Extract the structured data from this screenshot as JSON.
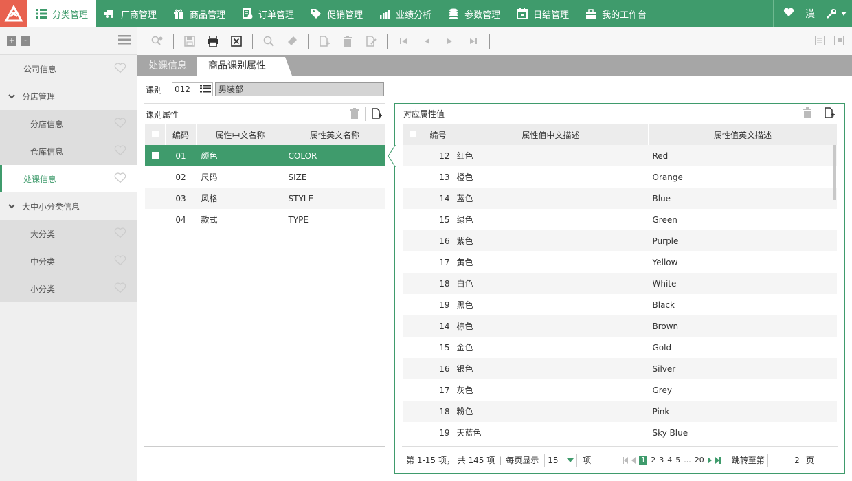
{
  "nav": {
    "items": [
      {
        "label": "分类管理",
        "icon": "grid-list-icon"
      },
      {
        "label": "厂商管理",
        "icon": "truck-icon"
      },
      {
        "label": "商品管理",
        "icon": "gift-icon"
      },
      {
        "label": "订单管理",
        "icon": "order-icon"
      },
      {
        "label": "促销管理",
        "icon": "tag-icon"
      },
      {
        "label": "业绩分析",
        "icon": "bar-chart-icon"
      },
      {
        "label": "参数管理",
        "icon": "database-icon"
      },
      {
        "label": "日结管理",
        "icon": "calendar-icon"
      },
      {
        "label": "我的工作台",
        "icon": "briefcase-icon"
      }
    ],
    "lang": "漢"
  },
  "sidebar": {
    "items": [
      {
        "label": "公司信息"
      },
      {
        "label": "分店管理"
      },
      {
        "label": "分店信息"
      },
      {
        "label": "仓库信息"
      },
      {
        "label": "处课信息"
      },
      {
        "label": "大中小分类信息"
      },
      {
        "label": "大分类"
      },
      {
        "label": "中分类"
      },
      {
        "label": "小分类"
      }
    ]
  },
  "tabs": [
    {
      "label": "处课信息"
    },
    {
      "label": "商品课别属性"
    }
  ],
  "category": {
    "label": "课别",
    "code": "012",
    "name": "男装部"
  },
  "left_panel": {
    "title": "课别属性",
    "headers": [
      "编码",
      "属性中文名称",
      "属性英文名称"
    ],
    "rows": [
      {
        "code": "01",
        "cn": "颜色",
        "en": "COLOR"
      },
      {
        "code": "02",
        "cn": "尺码",
        "en": "SIZE"
      },
      {
        "code": "03",
        "cn": "风格",
        "en": "STYLE"
      },
      {
        "code": "04",
        "cn": "款式",
        "en": "TYPE"
      }
    ]
  },
  "right_panel": {
    "title": "对应属性值",
    "headers": [
      "编号",
      "属性值中文描述",
      "属性值英文描述"
    ],
    "rows": [
      {
        "no": "12",
        "cn": "红色",
        "en": "Red"
      },
      {
        "no": "13",
        "cn": "橙色",
        "en": "Orange"
      },
      {
        "no": "14",
        "cn": "蓝色",
        "en": "Blue"
      },
      {
        "no": "15",
        "cn": "绿色",
        "en": "Green"
      },
      {
        "no": "16",
        "cn": "紫色",
        "en": "Purple"
      },
      {
        "no": "17",
        "cn": "黄色",
        "en": "Yellow"
      },
      {
        "no": "18",
        "cn": "白色",
        "en": "White"
      },
      {
        "no": "19",
        "cn": "黑色",
        "en": "Black"
      },
      {
        "no": "14",
        "cn": "棕色",
        "en": "Brown"
      },
      {
        "no": "15",
        "cn": "金色",
        "en": "Gold"
      },
      {
        "no": "16",
        "cn": "银色",
        "en": "Silver"
      },
      {
        "no": "17",
        "cn": "灰色",
        "en": "Grey"
      },
      {
        "no": "18",
        "cn": "粉色",
        "en": "Pink"
      },
      {
        "no": "19",
        "cn": "天蓝色",
        "en": "Sky Blue"
      }
    ]
  },
  "pager": {
    "summary": "第 1-15 项， 共 145 项",
    "per_page_label": "每页显示",
    "per_page_value": "15",
    "per_page_unit": "项",
    "pages": [
      "1",
      "2",
      "3",
      "4",
      "5",
      "...",
      "20"
    ],
    "jump_label": "跳转至第",
    "jump_value": "2",
    "jump_unit": "页"
  },
  "colors": {
    "accent": "#3f9b6c",
    "logo": "#e8614f",
    "tab_bar": "#a6a6a6"
  }
}
